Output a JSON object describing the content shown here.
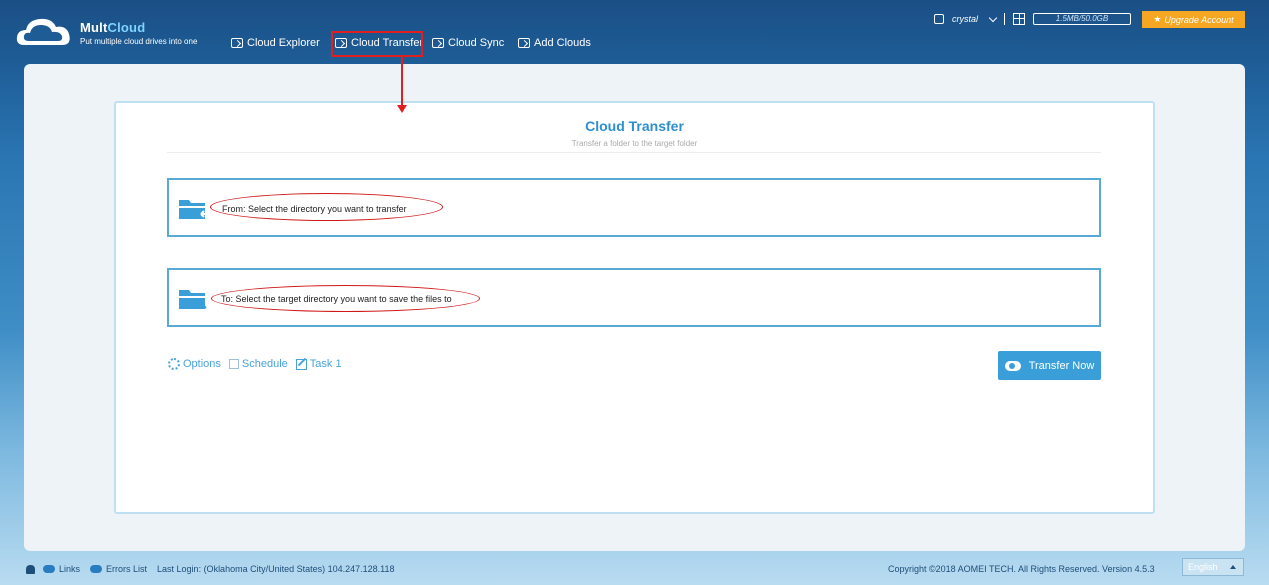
{
  "header": {
    "brand_prefix": "Mult",
    "brand_suffix": "Cloud",
    "tagline": "Put multiple cloud drives into one",
    "nav": [
      {
        "label": "Cloud Explorer",
        "icon": "explorer-icon"
      },
      {
        "label": "Cloud Transfer",
        "icon": "transfer-icon",
        "active": true
      },
      {
        "label": "Cloud Sync",
        "icon": "sync-icon"
      },
      {
        "label": "Add Clouds",
        "icon": "add-icon"
      }
    ],
    "user_name": "crystal",
    "quota": "1.5MB/50.0GB",
    "upgrade_label": "Upgrade Account"
  },
  "main": {
    "title": "Cloud Transfer",
    "subtitle": "Transfer a folder to the target folder",
    "from_label": "From: Select the directory you want to transfer",
    "to_label": "To: Select the target directory you want to save the files to",
    "options_label": "Options",
    "schedule_label": "Schedule",
    "task_label": "Task 1",
    "transfer_button": "Transfer Now"
  },
  "footer": {
    "links_label": "Links",
    "errors_label": "Errors List",
    "last_login": "Last Login: (Oklahoma City/United States) 104.247.128.118",
    "copyright": "Copyright ©2018 AOMEI TECH. All Rights Reserved. Version 4.5.3",
    "language": "English"
  },
  "colors": {
    "accent": "#3a9fd8",
    "annotation": "#e02020",
    "upgrade": "#f5a623"
  }
}
